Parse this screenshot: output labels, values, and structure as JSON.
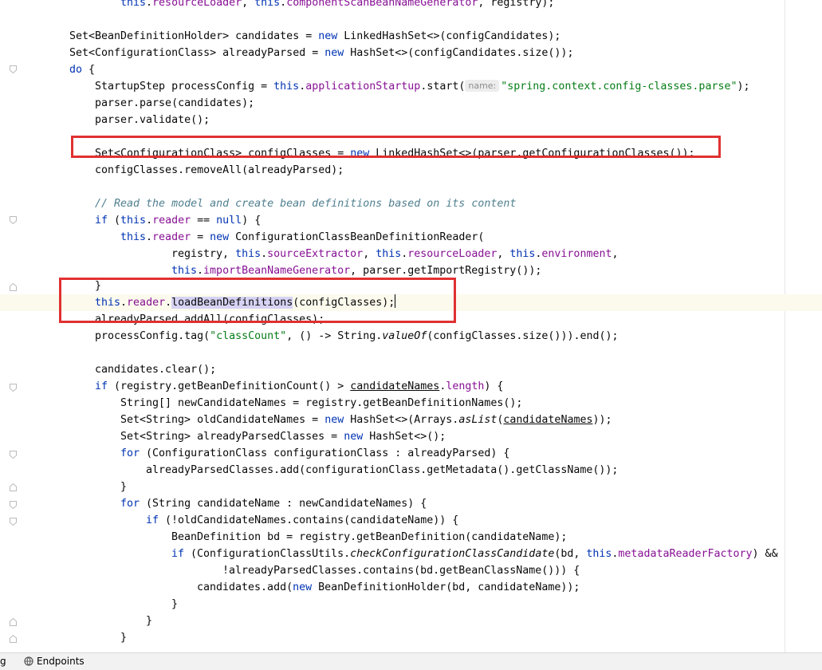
{
  "editor": {
    "lines": {
      "l0": [
        "this",
        ".",
        "resourceLoader",
        ", ",
        "this",
        ".",
        "componentScanBeanNameGenerator",
        ", registry);"
      ],
      "l2": [
        "Set<BeanDefinitionHolder> candidates = ",
        "new",
        " LinkedHashSet<>(configCandidates);"
      ],
      "l3": [
        "Set<ConfigurationClass> alreadyParsed = ",
        "new",
        " HashSet<>(configCandidates.size());"
      ],
      "l4": [
        "do",
        " {"
      ],
      "l5": [
        "StartupStep processConfig = ",
        "this",
        ".",
        "applicationStartup",
        ".start(",
        "name:",
        " ",
        "\"spring.context.config-classes.parse\"",
        ");"
      ],
      "l6": [
        "parser.parse(candidates);"
      ],
      "l7": [
        "parser.validate();"
      ],
      "l9": [
        "Set<ConfigurationClass> configClasses = ",
        "new",
        " LinkedHashSet<>(parser.getConfigurationClasses());"
      ],
      "l10": [
        "configClasses.removeAll(alreadyParsed);"
      ],
      "l12": [
        "// Read the model and create bean definitions based on its content"
      ],
      "l13": [
        "if",
        " (",
        "this",
        ".",
        "reader",
        " == ",
        "null",
        ") {"
      ],
      "l14": [
        "this",
        ".",
        "reader",
        " = ",
        "new",
        " ConfigurationClassBeanDefinitionReader("
      ],
      "l15": [
        "registry, ",
        "this",
        ".",
        "sourceExtractor",
        ", ",
        "this",
        ".",
        "resourceLoader",
        ", ",
        "this",
        ".",
        "environment",
        ","
      ],
      "l16": [
        "this",
        ".",
        "importBeanNameGenerator",
        ", parser.getImportRegistry());"
      ],
      "l17": [
        "}"
      ],
      "l18": [
        "this",
        ".",
        "reader",
        ".",
        "loadBeanDefinitions",
        "(configClasses);"
      ],
      "l19": [
        "alreadyParsed.addAll(configClasses);"
      ],
      "l20": [
        "processConfig.tag(",
        "\"classCount\"",
        ", () -> String.",
        "valueOf",
        "(configClasses.size())).end();"
      ],
      "l22": [
        "candidates.clear();"
      ],
      "l23": [
        "if",
        " (registry.getBeanDefinitionCount() > ",
        "candidateNames",
        ".",
        "length",
        ") {"
      ],
      "l24": [
        "String[] newCandidateNames = registry.getBeanDefinitionNames();"
      ],
      "l25": [
        "Set<String> oldCandidateNames = ",
        "new",
        " HashSet<>(Arrays.",
        "asList",
        "(",
        "candidateNames",
        "));"
      ],
      "l26": [
        "Set<String> alreadyParsedClasses = ",
        "new",
        " HashSet<>();"
      ],
      "l27": [
        "for",
        " (ConfigurationClass configurationClass : alreadyParsed) {"
      ],
      "l28": [
        "alreadyParsedClasses.add(configurationClass.getMetadata().getClassName());"
      ],
      "l29": [
        "}"
      ],
      "l30": [
        "for",
        " (String candidateName : newCandidateNames) {"
      ],
      "l31": [
        "if",
        " (!oldCandidateNames.contains(candidateName)) {"
      ],
      "l32": [
        "BeanDefinition bd = registry.getBeanDefinition(candidateName);"
      ],
      "l33": [
        "if",
        " (ConfigurationClassUtils.",
        "checkConfigurationClassCandidate",
        "(bd, ",
        "this",
        ".",
        "metadataReaderFactory",
        ") &&"
      ],
      "l34": [
        "!alreadyParsedClasses.contains(bd.getBeanClassName())) {"
      ],
      "l35": [
        "candidates.add(",
        "new",
        " BeanDefinitionHolder(bd, candidateName));"
      ],
      "l36": [
        "}"
      ],
      "l37": [
        "}"
      ],
      "l38": [
        "}"
      ]
    }
  },
  "statusbar": {
    "left_fragment": "g",
    "endpoints_label": "Endpoints",
    "endpoints_icon": "globe-icon"
  },
  "colors": {
    "keyword": "#0033b3",
    "field": "#871094",
    "string": "#067d17",
    "comment": "#4f7f8f",
    "annotation_box": "#e03131",
    "current_line": "#fcfaed",
    "identifier_highlight": "#d6d3f4"
  }
}
